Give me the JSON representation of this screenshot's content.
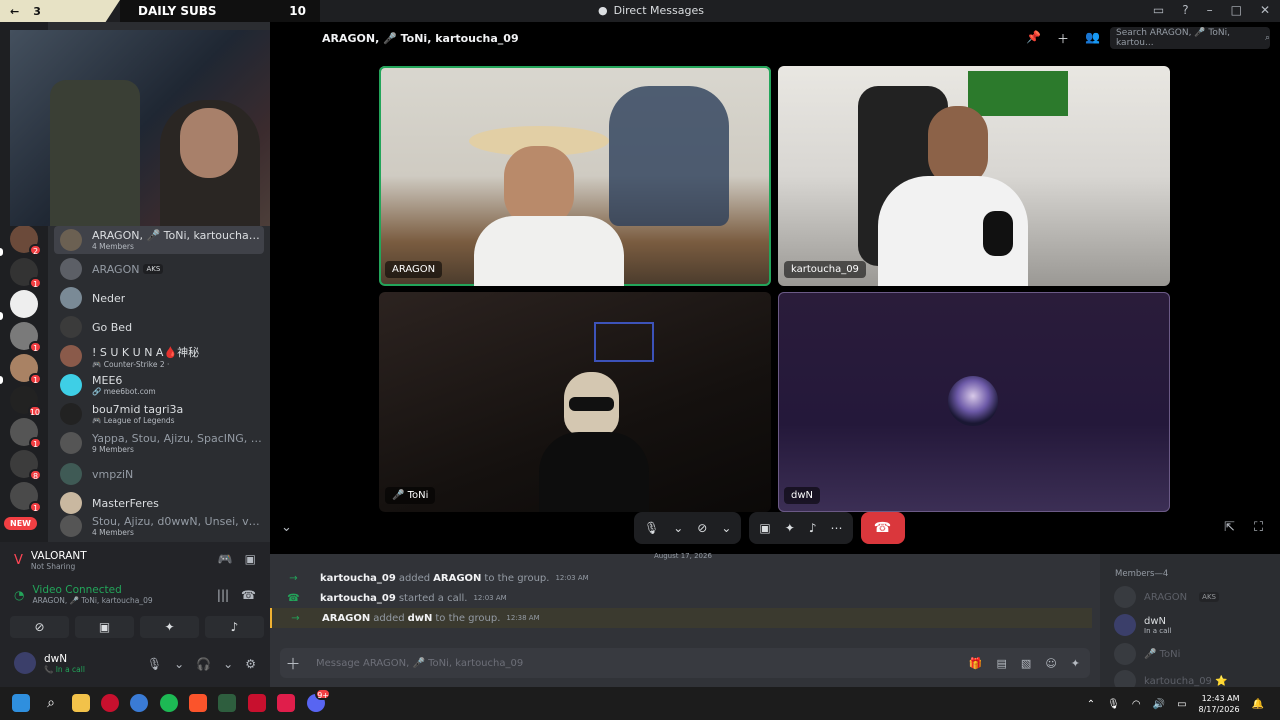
{
  "stream_overlay": {
    "subs_count": "3",
    "subs_label": "DAILY SUBS",
    "subs_goal": "10"
  },
  "titlebar": {
    "back_icon": "arrow-left-icon",
    "title": "Direct Messages",
    "controls": [
      "inbox-icon",
      "help-icon",
      "minimize-icon",
      "maximize-icon",
      "close-icon"
    ]
  },
  "server_rail": {
    "new_badge": "NEW",
    "badges": [
      "2",
      "1",
      "1",
      "1",
      "1",
      "10",
      "1",
      "8",
      "1",
      "1"
    ]
  },
  "dm_list": {
    "items": [
      {
        "name": "ARAGON, 🎤 ToNi, kartoucha_09",
        "sub": "4 Members",
        "active": true
      },
      {
        "name": "ARAGON",
        "tag": "AKS",
        "dim": true
      },
      {
        "name": "Neder"
      },
      {
        "name": "Go Bed"
      },
      {
        "name": "! S U K U N A🩸神秘",
        "sub": "🎮 Counter-Strike 2 ·"
      },
      {
        "name": "MEE6",
        "sub": "🔗 mee6bot.com"
      },
      {
        "name": "bou7mid tagri3a",
        "sub": "🎮 League of Legends"
      },
      {
        "name": "Yappa, Stou, Ajizu, SpacING, d0ww...",
        "sub": "9 Members",
        "dim": true
      },
      {
        "name": "vmpziN",
        "dim": true
      },
      {
        "name": "MasterFeres"
      },
      {
        "name": "Stou, Ajizu, d0wwN, Unsei, vmpziN",
        "sub": "4 Members",
        "dim": true
      }
    ]
  },
  "user_panel": {
    "activity_title": "VALORANT",
    "activity_sub": "Not Sharing",
    "voice_status": "Video Connected",
    "voice_channel": "ARAGON, 🎤 ToNi, kartoucha_09",
    "username": "dwN",
    "user_status": "📞 In a call"
  },
  "call": {
    "header_title": "ARAGON, 🎤 ToNi, kartoucha_09",
    "search_placeholder": "Search ARAGON, 🎤 ToNi, kartou...",
    "tiles": [
      {
        "name": "ARAGON",
        "speaking": true
      },
      {
        "name": "kartoucha_09",
        "speaking": false
      },
      {
        "name": "🎤 ToNi",
        "speaking": false
      },
      {
        "name": "dwN",
        "speaking": false
      }
    ]
  },
  "chat": {
    "date_divider": "August 17, 2026",
    "messages": [
      {
        "icon": "→",
        "actor": "kartoucha_09",
        "verb": "added",
        "target": "ARAGON",
        "suffix": "to the group.",
        "time": "12:03 AM",
        "highlight": false
      },
      {
        "icon": "📞",
        "actor": "kartoucha_09",
        "verb": "started a call.",
        "target": "",
        "suffix": "",
        "time": "12:03 AM",
        "highlight": false
      },
      {
        "icon": "→",
        "actor": "ARAGON",
        "verb": "added",
        "target": "dwN",
        "suffix": "to the group.",
        "time": "12:38 AM",
        "highlight": true
      }
    ],
    "input_placeholder": "Message ARAGON, 🎤 ToNi, kartoucha_09"
  },
  "members": {
    "title": "Members—4",
    "list": [
      {
        "name": "ARAGON",
        "tag": "AKS",
        "dim": true
      },
      {
        "name": "dwN",
        "sub": "In a call",
        "dim": false
      },
      {
        "name": "🎤 ToNi",
        "dim": true
      },
      {
        "name": "kartoucha_09 ⭐",
        "dim": true
      }
    ]
  },
  "taskbar": {
    "time": "12:43 AM",
    "date": "8/17/2026",
    "discord_badge": "9+"
  },
  "colors": {
    "accent_green": "#23a55a",
    "hangup_red": "#da373c",
    "badge_red": "#f23f43",
    "highlight_gold": "#f0b232"
  }
}
